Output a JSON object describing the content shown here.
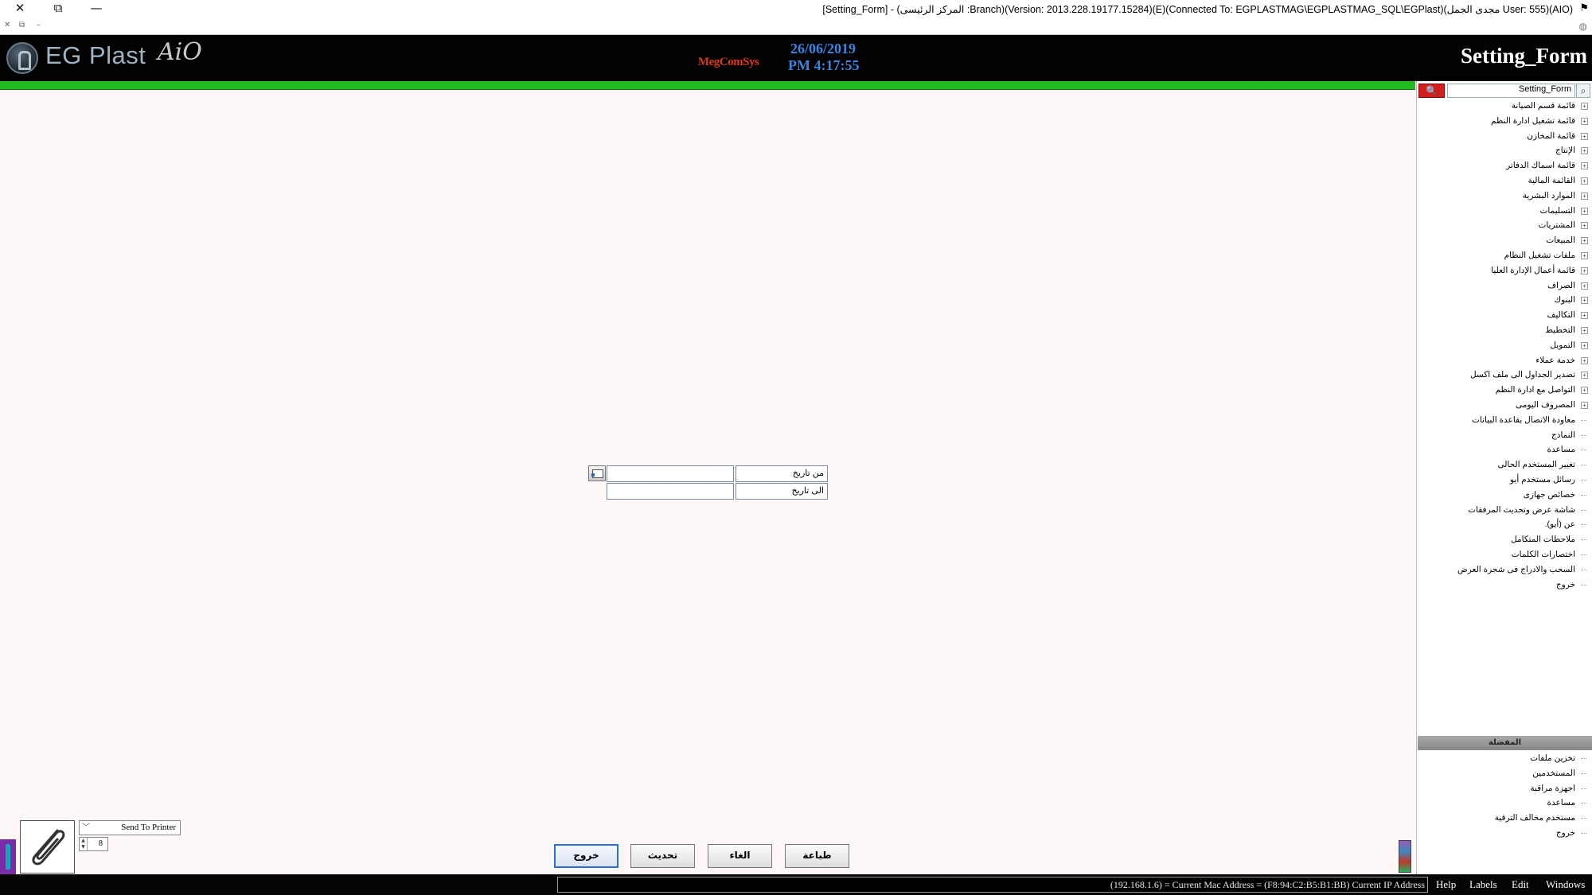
{
  "titlebar": {
    "title": "[Setting_Form] - (المركز الرئيسى :Branch)(Version: 2013.228.19177.15284)(E)(Connected To: EGPLASTMAG\\EGPLASTMAG_SQL\\EGPlast)(مجدى الجمل User: 555)(AIO)",
    "close_glyph": "✕",
    "restore_glyph": "⧉",
    "minimize_glyph": "—",
    "sub_close_glyph": "✕",
    "sub_restore_glyph": "⧉",
    "sub_min_glyph": "–"
  },
  "header": {
    "logo_text": "EG Plast",
    "logo_suffix": "AiO",
    "brand_mid": "MegComSys",
    "date": "26/06/2019",
    "time": "PM 4:17:55",
    "form_title": "Setting_Form"
  },
  "sidebar": {
    "search_value": "Setting_Form",
    "search_btn_glyph": "🔍",
    "search_icon_glyph": "⌕",
    "tree": [
      {
        "label": "قائمة قسم الصيانة",
        "expandable": true
      },
      {
        "label": "قائمة تشغيل ادارة النظم",
        "expandable": true
      },
      {
        "label": "قائمة المخازن",
        "expandable": true
      },
      {
        "label": "الإنتاج",
        "expandable": true
      },
      {
        "label": "قائمة اسماك الدفاتر",
        "expandable": true
      },
      {
        "label": "القائمة المالية",
        "expandable": true
      },
      {
        "label": "الموارد البشرية",
        "expandable": true
      },
      {
        "label": "التسليمات",
        "expandable": true
      },
      {
        "label": "المشتريات",
        "expandable": true
      },
      {
        "label": "المبيعات",
        "expandable": true
      },
      {
        "label": "ملفات تشغيل النظام",
        "expandable": true
      },
      {
        "label": "قائمة أعمال الإدارة العليا",
        "expandable": true
      },
      {
        "label": "الصراف",
        "expandable": true
      },
      {
        "label": "البنوك",
        "expandable": true
      },
      {
        "label": "التكاليف",
        "expandable": true
      },
      {
        "label": "التخطيط",
        "expandable": true
      },
      {
        "label": "التمويل",
        "expandable": true
      },
      {
        "label": "خدمة عملاء",
        "expandable": true
      },
      {
        "label": "تصدير الجداول الى ملف اكسل",
        "expandable": true
      },
      {
        "label": "التواصل مع ادارة النظم",
        "expandable": true
      },
      {
        "label": "المصروف اليومى",
        "expandable": true
      },
      {
        "label": "معاودة الاتصال بقاعدة البيانات",
        "expandable": false
      },
      {
        "label": "النماذج",
        "expandable": false
      },
      {
        "label": "مساعدة",
        "expandable": false
      },
      {
        "label": "تغيير المستخدم الحالى",
        "expandable": false
      },
      {
        "label": "رسائل مستخدم أيو",
        "expandable": false
      },
      {
        "label": "خصائص جهازى",
        "expandable": false
      },
      {
        "label": "شاشة عرض وتحديث المرفقات",
        "expandable": false
      },
      {
        "label": "عن (أيو).",
        "expandable": false
      },
      {
        "label": "ملاحظات المتكامل",
        "expandable": false
      },
      {
        "label": "اختصارات الكلمات",
        "expandable": false
      },
      {
        "label": "السحب والادراج فى شجرة العرض",
        "expandable": false
      },
      {
        "label": "خروج",
        "expandable": false
      }
    ],
    "favorites_header": "المفضلة",
    "favorites": [
      {
        "label": "تخزين ملفات"
      },
      {
        "label": "المستخدمين"
      },
      {
        "label": "اجهزة مراقبة"
      },
      {
        "label": "مساعدة"
      },
      {
        "label": "مستخدم مخالف الترقية"
      },
      {
        "label": "خروج"
      }
    ]
  },
  "form": {
    "from_date_label": "من تاريخ",
    "to_date_label": "الى تاريخ",
    "from_date_value": "",
    "to_date_value": ""
  },
  "print": {
    "printer_option": "Send To Printer",
    "copies": "8",
    "attach_glyph": "📎",
    "spin_up": "▲",
    "spin_down": "▼",
    "chevron": "﹀"
  },
  "buttons": {
    "exit": "خروج",
    "refresh": "تحديث",
    "cancel": "الغاء",
    "print": "طباعة"
  },
  "statusbar": {
    "ip_info": "(192.168.1.6) = Current Mac Address = (F8:94:C2:B5:B1:BB) Current IP Address",
    "menu": [
      "Help",
      "Labels",
      "Edit",
      "Windows"
    ]
  }
}
